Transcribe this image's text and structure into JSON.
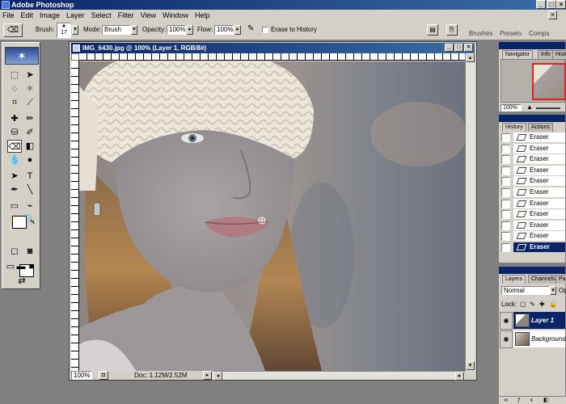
{
  "window": {
    "title": "Adobe Photoshop"
  },
  "menu": [
    "File",
    "Edit",
    "Image",
    "Layer",
    "Select",
    "Filter",
    "View",
    "Window",
    "Help"
  ],
  "options": {
    "brush_label": "Brush:",
    "brush_size": "17",
    "mode_label": "Mode:",
    "mode_value": "Brush",
    "opacity_label": "Opacity:",
    "opacity_value": "100%",
    "flow_label": "Flow:",
    "flow_value": "100%",
    "erase_history_label": "Erase to History",
    "well_tabs": [
      "Brushes",
      "Presets",
      "Comps"
    ]
  },
  "document": {
    "title": "IMG_6430.jpg @ 100% (Layer 1, RGB/8#)",
    "zoom": "100%",
    "doc_size": "Doc: 1.12M/2.52M"
  },
  "navigator": {
    "tabs": [
      "Navigator",
      "Info",
      "Histo"
    ],
    "zoom": "100%"
  },
  "history": {
    "tabs": [
      "History",
      "Actions"
    ],
    "items": [
      "Eraser",
      "Eraser",
      "Eraser",
      "Eraser",
      "Eraser",
      "Eraser",
      "Eraser",
      "Eraser",
      "Eraser",
      "Eraser",
      "Eraser"
    ],
    "selected_index": 10
  },
  "layers": {
    "tabs": [
      "Layers",
      "Channels",
      "Pa"
    ],
    "blend_mode": "Normal",
    "opacity_label": "Op",
    "lock_label": "Lock:",
    "items": [
      {
        "name": "Layer 1",
        "selected": true
      },
      {
        "name": "Background",
        "selected": false
      }
    ]
  },
  "colors": {
    "title_bar": "#0a246a",
    "chrome": "#d4d0c8",
    "workspace": "#808080"
  }
}
